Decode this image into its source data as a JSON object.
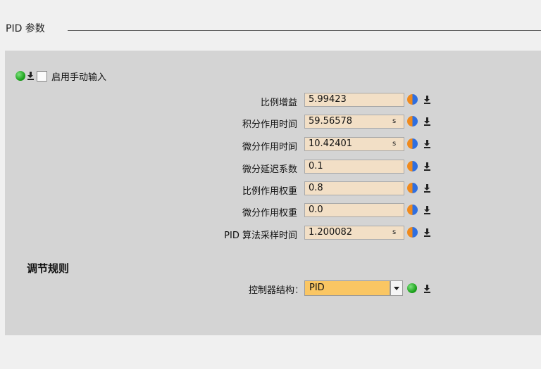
{
  "section": {
    "title": "PID 参数"
  },
  "manual_input": {
    "label": "启用手动输入",
    "checked": false,
    "status_color": "#1fa51f"
  },
  "params": [
    {
      "label": "比例增益",
      "colon": "：",
      "value": "5.99423",
      "unit": ""
    },
    {
      "label": "积分作用时间",
      "colon": "：",
      "value": "59.56578",
      "unit": "s"
    },
    {
      "label": "微分作用时间",
      "colon": "：",
      "value": "10.42401",
      "unit": "s"
    },
    {
      "label": "微分延迟系数",
      "colon": "：",
      "value": "0.1",
      "unit": ""
    },
    {
      "label": "比例作用权重",
      "colon": "：",
      "value": "0.8",
      "unit": ""
    },
    {
      "label": "微分作用权重",
      "colon": "：",
      "value": "0.0",
      "unit": ""
    },
    {
      "label": "PID 算法采样时间",
      "colon": "：",
      "value": "1.200082",
      "unit": "s"
    }
  ],
  "control_rule": {
    "heading": "调节规则",
    "structure_label": "控制器结构",
    "colon": "：",
    "structure_value": "PID"
  },
  "colors": {
    "input_bg": "#f2dfc6",
    "select_bg": "#fac663",
    "panel_bg": "#d4d4d4"
  },
  "icons": {
    "status": "green-status-icon",
    "download": "download-icon",
    "half_circle": "orange-blue-half-circle-icon",
    "dropdown": "chevron-down-icon"
  }
}
